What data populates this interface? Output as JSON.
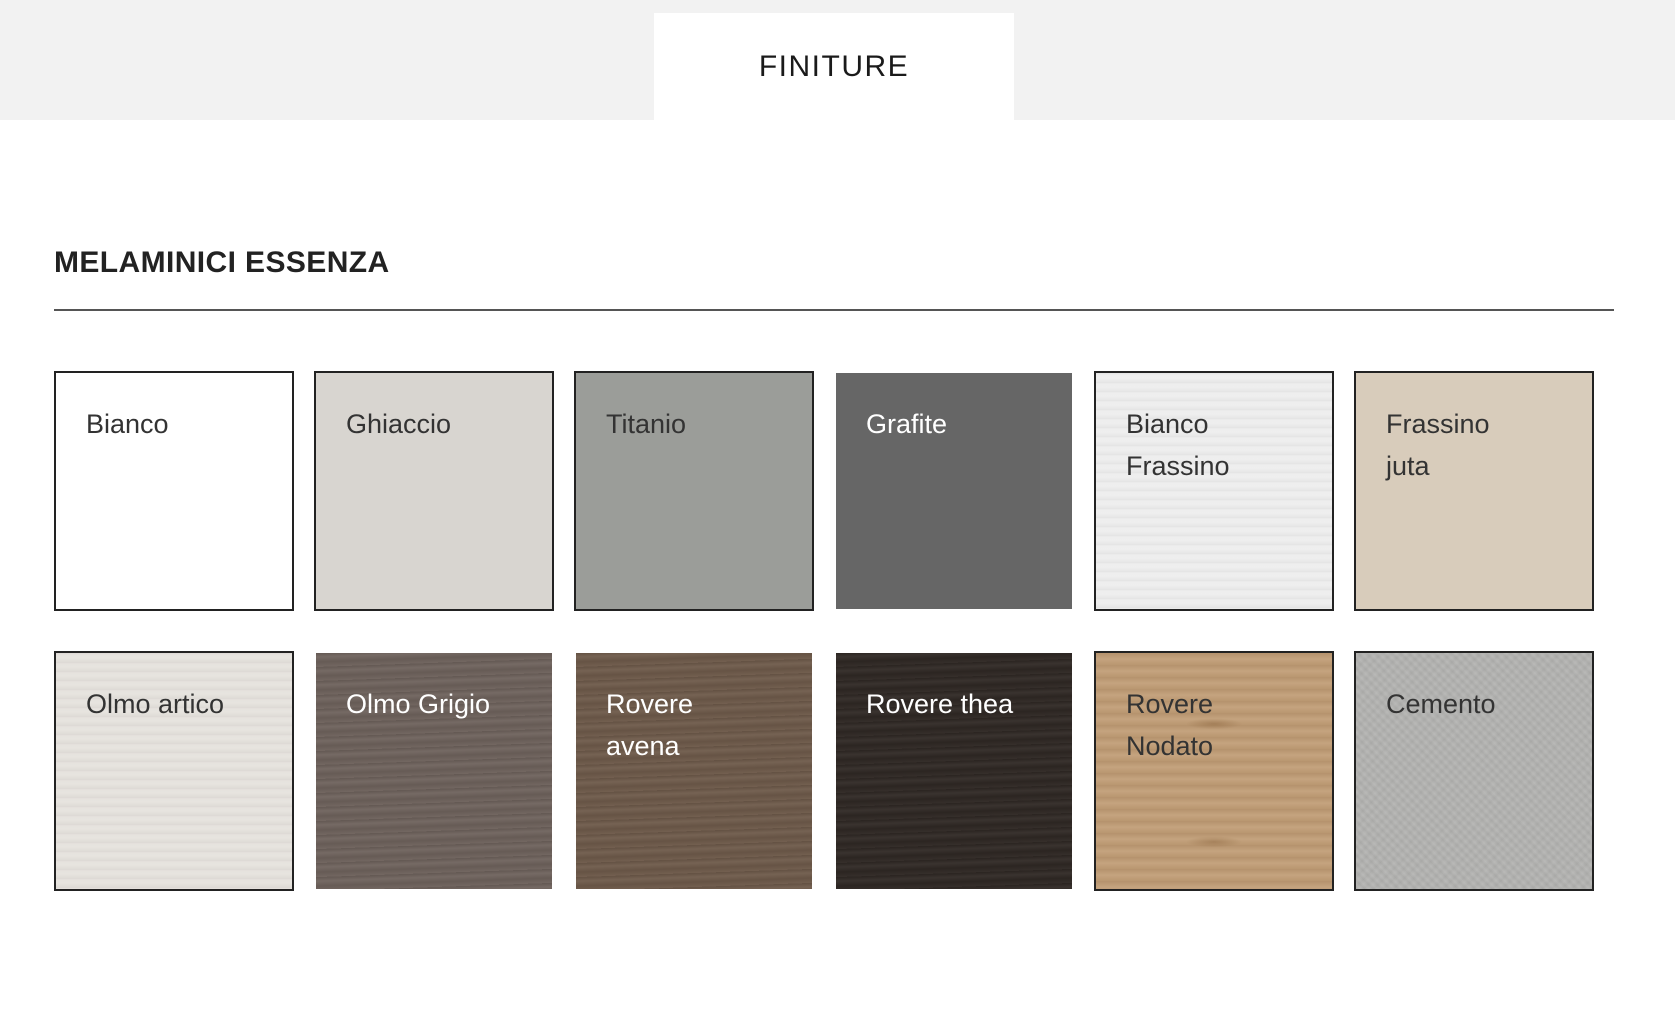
{
  "tabs": [
    {
      "label": "FINITURE",
      "active": true
    }
  ],
  "section": {
    "title": "MELAMINICI ESSENZA"
  },
  "swatches": [
    {
      "label": "Bianco",
      "color": "#ffffff",
      "text_color": "#333333"
    },
    {
      "label": "Ghiaccio",
      "color": "#d8d5d0",
      "text_color": "#333333"
    },
    {
      "label": "Titanio",
      "color": "#9b9d99",
      "text_color": "#333333"
    },
    {
      "label": "Grafite",
      "color": "#666666",
      "text_color": "#ffffff"
    },
    {
      "label": "Bianco Frassino",
      "color": "#eeeeee",
      "text_color": "#333333"
    },
    {
      "label": "Frassino juta",
      "color": "#d8ccbb",
      "text_color": "#333333"
    },
    {
      "label": "Olmo artico",
      "color": "#e6e3de",
      "text_color": "#333333"
    },
    {
      "label": "Olmo Grigio",
      "color": "#6e625c",
      "text_color": "#ffffff"
    },
    {
      "label": "Rovere avena",
      "color": "#6e5a4a",
      "text_color": "#ffffff"
    },
    {
      "label": "Rovere thea",
      "color": "#2f2824",
      "text_color": "#ffffff"
    },
    {
      "label": "Rovere Nodato",
      "color": "#c19e77",
      "text_color": "#333333"
    },
    {
      "label": "Cemento",
      "color": "#b3b3b1",
      "text_color": "#333333"
    }
  ]
}
